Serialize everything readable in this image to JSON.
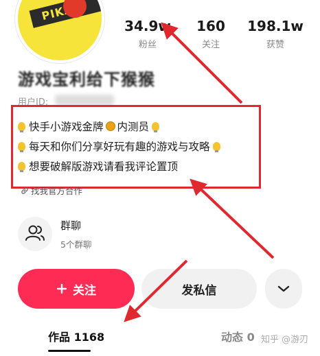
{
  "stats": [
    {
      "value": "34.9w",
      "label": "粉丝"
    },
    {
      "value": "160",
      "label": "关注"
    },
    {
      "value": "198.1w",
      "label": "获赞"
    }
  ],
  "profile": {
    "avatar_text": "PIKA",
    "username": "游戏宝利给下猴猴",
    "user_id_label": "用户ID:"
  },
  "bio": {
    "lines": [
      {
        "pre": "快手小游戏金牌",
        "post": "内测员"
      },
      {
        "text": "每天和你们分享好玩有趣的游戏与攻略"
      },
      {
        "text": "想要破解版游戏请看我评论置顶"
      }
    ],
    "link": "找我官方合作"
  },
  "group": {
    "title": "群聊",
    "subtitle": "5个群聊"
  },
  "actions": {
    "follow": "关注",
    "message": "发私信"
  },
  "tabs": {
    "works": "作品 1168",
    "dynamic": "动态 0"
  },
  "watermark": "知乎 @游刃",
  "colors": {
    "accent": "#fe2c55",
    "annotation": "#e0282f"
  }
}
